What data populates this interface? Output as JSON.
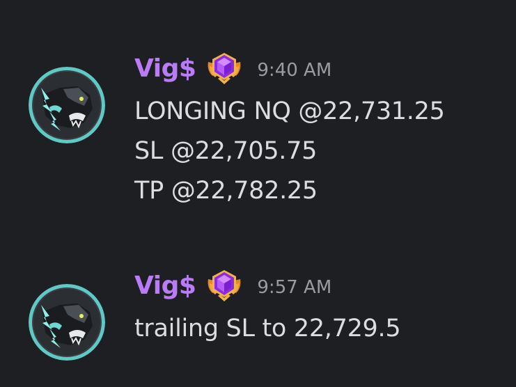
{
  "messages": [
    {
      "author": "Vig$",
      "badge_icon": "purple-hexagon-gem-badge-icon",
      "timestamp": "9:40 AM",
      "lines": [
        "LONGING NQ @22,731.25",
        "SL @22,705.75",
        "TP @22,782.25"
      ]
    },
    {
      "author": "Vig$",
      "badge_icon": "purple-hexagon-gem-badge-icon",
      "timestamp": "9:57 AM",
      "lines": [
        "trailing SL to 22,729.5"
      ]
    }
  ],
  "colors": {
    "background": "#1e1f22",
    "username": "#b97cf6",
    "timestamp": "#9a9ca3",
    "message_text": "#dbdee1"
  }
}
